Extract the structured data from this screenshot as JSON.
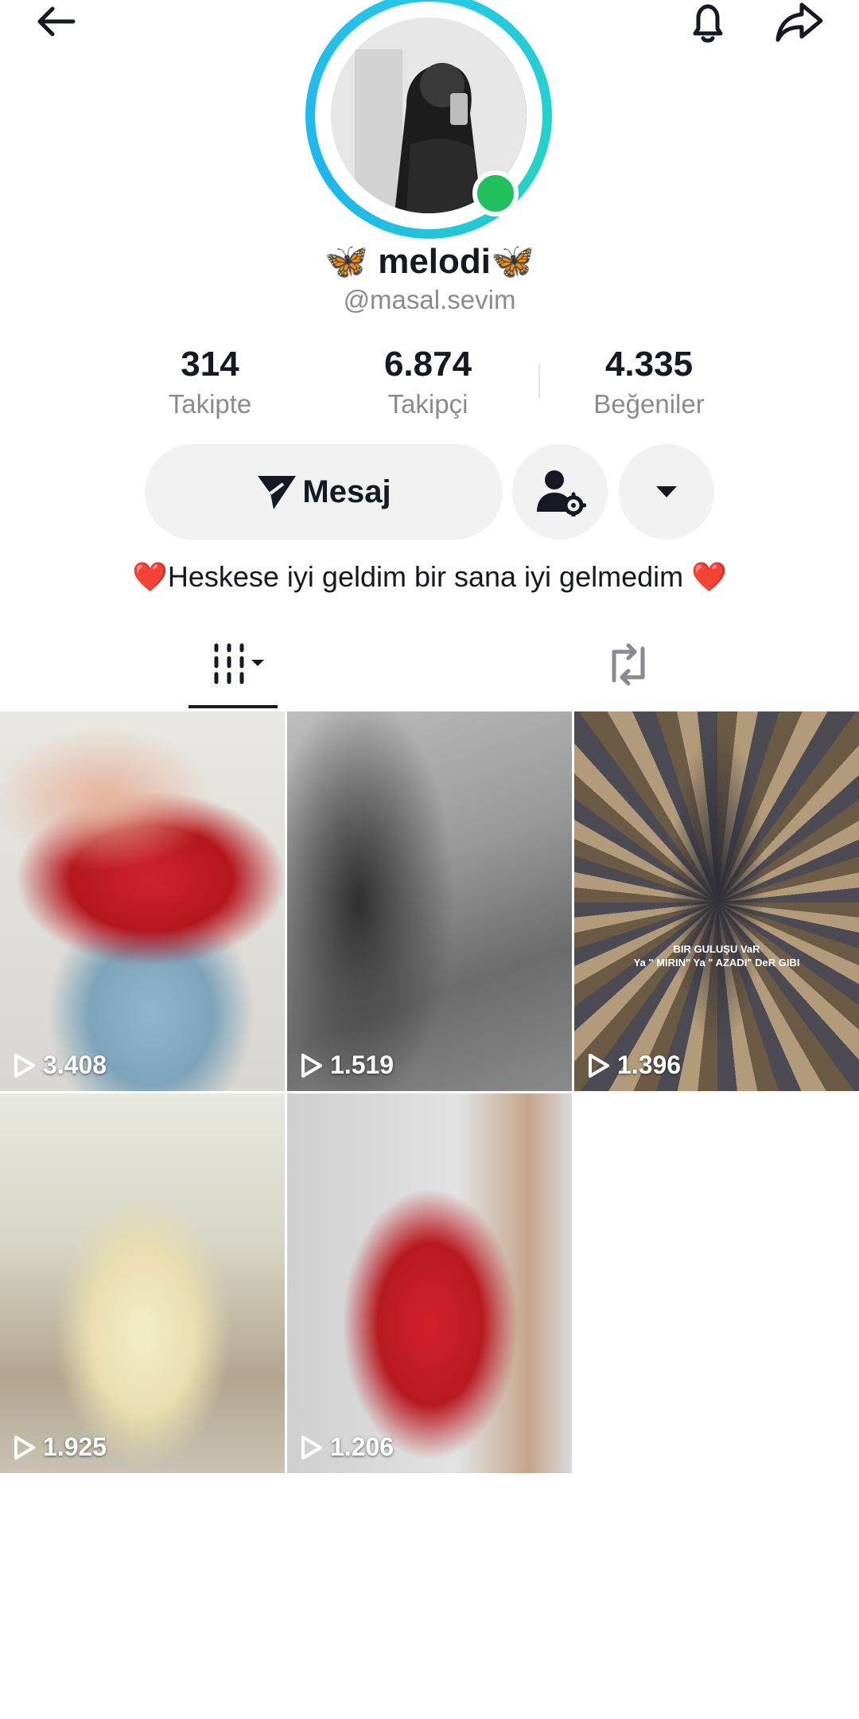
{
  "header": {
    "back_icon": "arrow-left-icon",
    "bell_icon": "bell-icon",
    "share_icon": "share-arrow-icon"
  },
  "profile": {
    "display_name": "🦋 melodi🦋",
    "username": "@masal.sevim",
    "online": true,
    "stats": {
      "following_count": "314",
      "following_label": "Takipte",
      "followers_count": "6.874",
      "followers_label": "Takipçi",
      "likes_count": "4.335",
      "likes_label": "Beğeniler"
    },
    "actions": {
      "message_label": "Mesaj",
      "friend_icon": "person-gear-icon",
      "more_icon": "caret-down-icon"
    },
    "bio": "❤️Heskese iyi geldim bir sana iyi gelmedim ❤️"
  },
  "tabs": [
    {
      "name": "videos",
      "icon": "grid-icon",
      "active": true
    },
    {
      "name": "reposts",
      "icon": "repost-icon",
      "active": false
    }
  ],
  "videos": [
    {
      "views": "3.408"
    },
    {
      "views": "1.519"
    },
    {
      "views": "1.396",
      "caption_line1": "BIR GULUŞU VaR",
      "caption_line2": "Ya \" MIRIN\" Ya \" AZADI\" DeR GIBI"
    },
    {
      "views": "1.925"
    },
    {
      "views": "1.206"
    }
  ],
  "colors": {
    "accent_ring": "#25c7e8",
    "online": "#20c05c",
    "muted_text": "#8a8b91",
    "button_bg": "#f1f1f2"
  }
}
